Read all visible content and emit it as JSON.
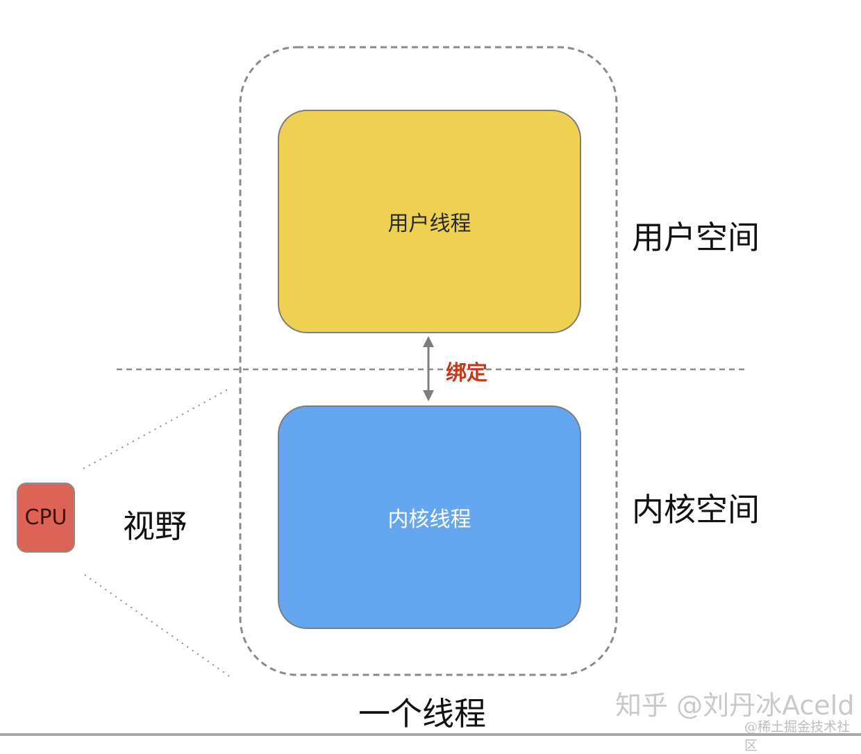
{
  "diagram": {
    "user_thread": "用户线程",
    "kernel_thread": "内核线程",
    "user_space": "用户空间",
    "kernel_space": "内核空间",
    "binding": "绑定",
    "cpu": "CPU",
    "view": "视野",
    "one_thread": "一个线程"
  },
  "colors": {
    "user_thread_fill": "#eed152",
    "kernel_thread_fill": "#64a6f0",
    "cpu_fill": "#dd6356",
    "binding_text": "#c23a1e"
  },
  "watermark": {
    "primary": "知乎 @刘丹冰Aceld",
    "secondary": "@稀土掘金技术社区"
  }
}
